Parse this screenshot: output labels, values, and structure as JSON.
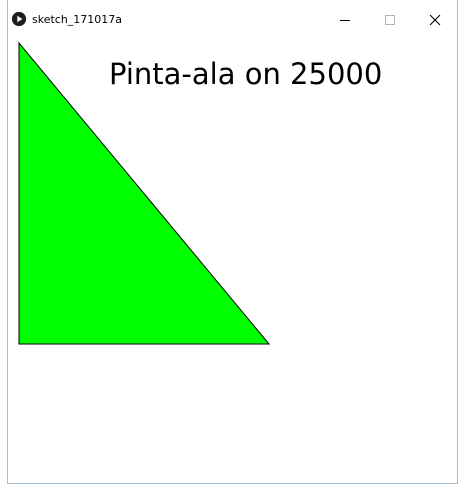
{
  "window": {
    "title": "sketch_171017a"
  },
  "sketch": {
    "text": "Pinta-ala on 25000",
    "shape_fill": "#00ff00",
    "shape_stroke": "#000000",
    "text_color": "#000000",
    "background": "#ffffff"
  },
  "icons": {
    "app": "processing-play-icon",
    "minimize": "minimize-icon",
    "maximize": "maximize-icon",
    "close": "close-icon"
  }
}
